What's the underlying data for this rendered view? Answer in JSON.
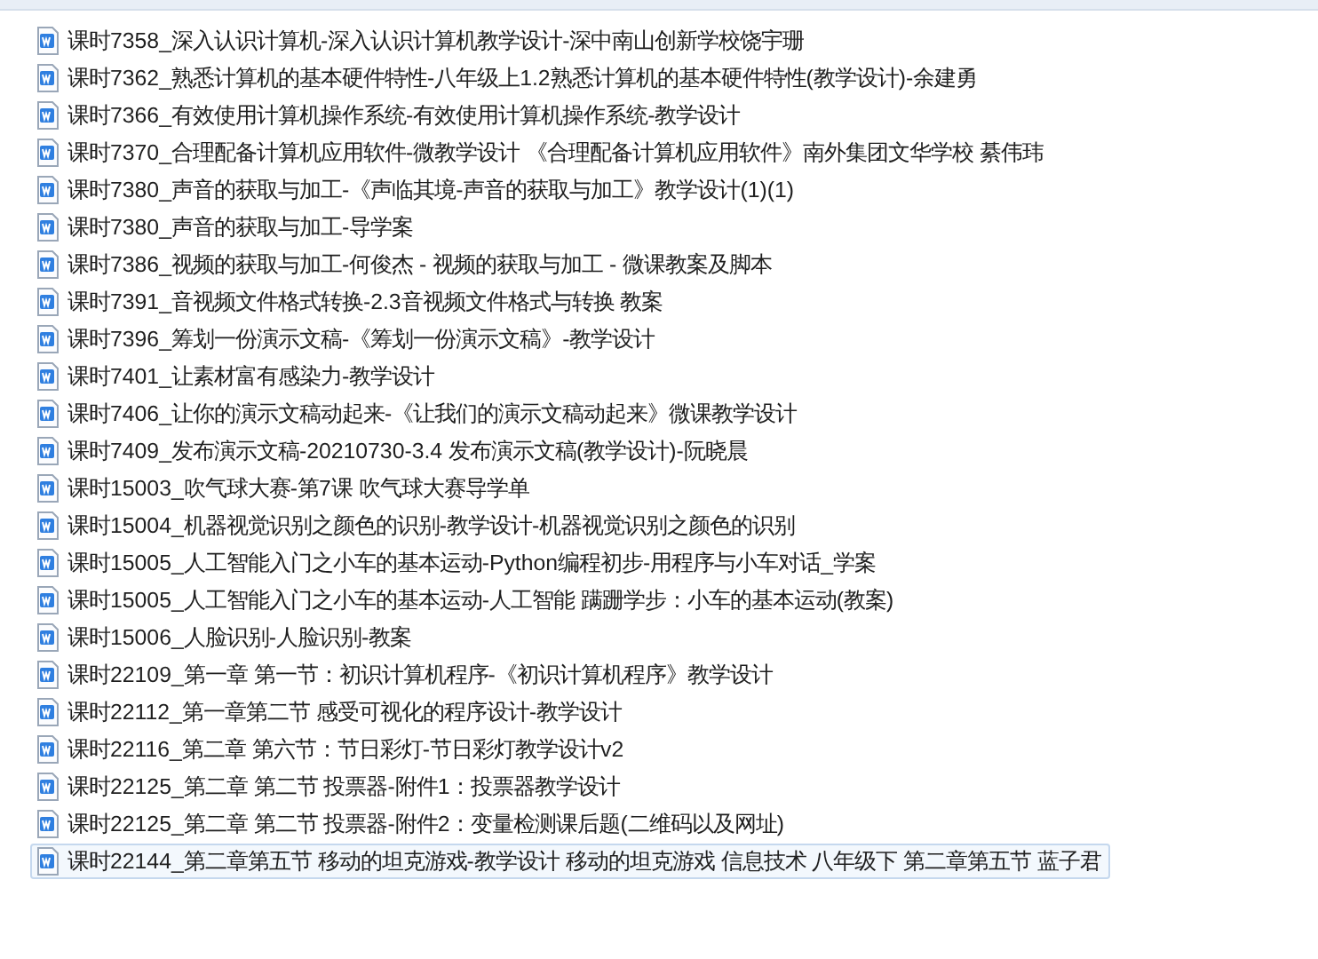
{
  "files": [
    {
      "name": "课时7358_深入认识计算机-深入认识计算机教学设计-深中南山创新学校饶宇珊",
      "selected": false
    },
    {
      "name": "课时7362_熟悉计算机的基本硬件特性-八年级上1.2熟悉计算机的基本硬件特性(教学设计)-余建勇",
      "selected": false
    },
    {
      "name": "课时7366_有效使用计算机操作系统-有效使用计算机操作系统-教学设计",
      "selected": false
    },
    {
      "name": "课时7370_合理配备计算机应用软件-微教学设计 《合理配备计算机应用软件》南外集团文华学校 綦伟玮",
      "selected": false
    },
    {
      "name": "课时7380_声音的获取与加工-《声临其境-声音的获取与加工》教学设计(1)(1)",
      "selected": false
    },
    {
      "name": "课时7380_声音的获取与加工-导学案",
      "selected": false
    },
    {
      "name": "课时7386_视频的获取与加工-何俊杰 - 视频的获取与加工 - 微课教案及脚本",
      "selected": false
    },
    {
      "name": "课时7391_音视频文件格式转换-2.3音视频文件格式与转换 教案",
      "selected": false
    },
    {
      "name": "课时7396_筹划一份演示文稿-《筹划一份演示文稿》-教学设计",
      "selected": false
    },
    {
      "name": "课时7401_让素材富有感染力-教学设计",
      "selected": false
    },
    {
      "name": "课时7406_让你的演示文稿动起来-《让我们的演示文稿动起来》微课教学设计",
      "selected": false
    },
    {
      "name": "课时7409_发布演示文稿-20210730-3.4 发布演示文稿(教学设计)-阮晓晨",
      "selected": false
    },
    {
      "name": "课时15003_吹气球大赛-第7课 吹气球大赛导学单",
      "selected": false
    },
    {
      "name": "课时15004_机器视觉识别之颜色的识别-教学设计-机器视觉识别之颜色的识别",
      "selected": false
    },
    {
      "name": "课时15005_人工智能入门之小车的基本运动-Python编程初步-用程序与小车对话_学案",
      "selected": false
    },
    {
      "name": "课时15005_人工智能入门之小车的基本运动-人工智能 蹒跚学步：小车的基本运动(教案)",
      "selected": false
    },
    {
      "name": "课时15006_人脸识别-人脸识别-教案",
      "selected": false
    },
    {
      "name": "课时22109_第一章 第一节：初识计算机程序-《初识计算机程序》教学设计",
      "selected": false
    },
    {
      "name": "课时22112_第一章第二节 感受可视化的程序设计-教学设计",
      "selected": false
    },
    {
      "name": "课时22116_第二章 第六节：节日彩灯-节日彩灯教学设计v2",
      "selected": false
    },
    {
      "name": "课时22125_第二章 第二节 投票器-附件1：投票器教学设计",
      "selected": false
    },
    {
      "name": "课时22125_第二章 第二节 投票器-附件2：变量检测课后题(二维码以及网址)",
      "selected": false
    },
    {
      "name": "课时22144_第二章第五节 移动的坦克游戏-教学设计 移动的坦克游戏 信息技术 八年级下 第二章第五节 蓝子君",
      "selected": true
    }
  ]
}
